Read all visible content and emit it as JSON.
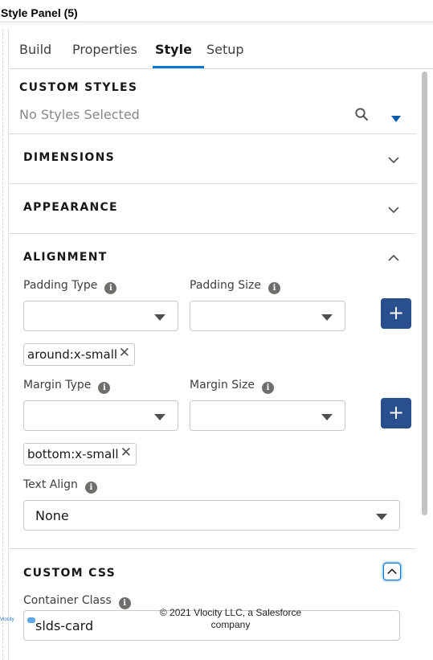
{
  "window": {
    "title": "Style Panel (5)"
  },
  "tabs": [
    {
      "label": "Build",
      "active": false
    },
    {
      "label": "Properties",
      "active": false
    },
    {
      "label": "Style",
      "active": true
    },
    {
      "label": "Setup",
      "active": false
    }
  ],
  "custom_styles": {
    "title": "CUSTOM STYLES",
    "placeholder": "No Styles Selected",
    "search_icon": "search-icon",
    "dropdown_icon": "triangle-down-icon",
    "accent_color": "#0176d3"
  },
  "sections": {
    "dimensions": {
      "title": "DIMENSIONS",
      "expanded": false
    },
    "appearance": {
      "title": "APPEARANCE",
      "expanded": false
    },
    "alignment": {
      "title": "ALIGNMENT",
      "expanded": true
    },
    "custom_css": {
      "title": "CUSTOM CSS",
      "expanded": true
    }
  },
  "alignment": {
    "padding_type_label": "Padding Type",
    "padding_size_label": "Padding Size",
    "padding_type_value": "",
    "padding_size_value": "",
    "padding_pill": "around:x-small",
    "margin_type_label": "Margin Type",
    "margin_size_label": "Margin Size",
    "margin_type_value": "",
    "margin_size_value": "",
    "margin_pill": "bottom:x-small",
    "text_align_label": "Text Align",
    "text_align_value": "None",
    "add_button_label": "+",
    "remove_label": "✕",
    "info_label": "i",
    "button_color": "#2a4f8e"
  },
  "custom_css": {
    "container_class_label": "Container Class",
    "container_class_value": "slds-card"
  },
  "footer": {
    "copyright": "© 2021 Vlocity LLC, a Salesforce company",
    "logo_text": "Vlocity"
  }
}
